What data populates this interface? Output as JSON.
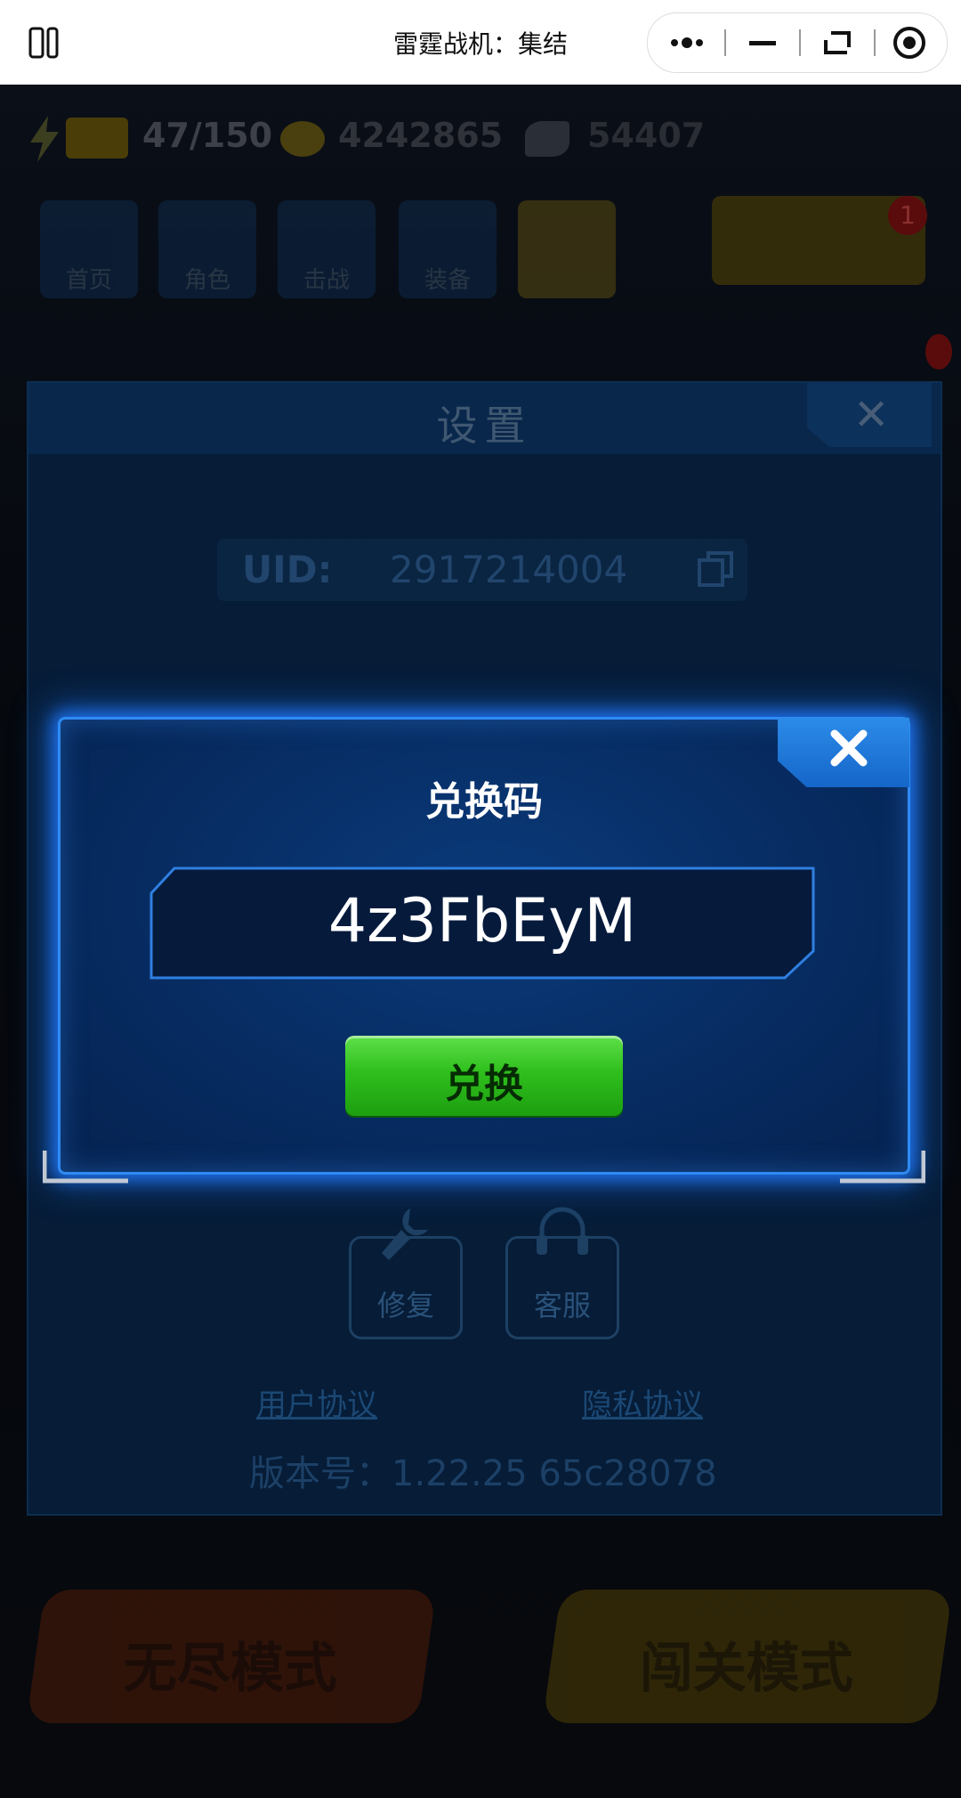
{
  "topbar": {
    "title": "雷霆战机：集结"
  },
  "game_bg": {
    "energy": "47/150",
    "coins": "4242865",
    "gems": "54407",
    "tiles": [
      "首页",
      "角色",
      "击战",
      "装备"
    ],
    "badge_count": "1"
  },
  "settings": {
    "title": "设置",
    "uid_label": "UID:",
    "uid_value": "2917214004",
    "repair_label": "修复",
    "service_label": "客服",
    "user_agreement": "用户协议",
    "privacy_agreement": "隐私协议",
    "version": "版本号：1.22.25   65c28078"
  },
  "modes": {
    "endless": "无尽模式",
    "stage": "闯关模式"
  },
  "redeem": {
    "title": "兑换码",
    "code_value": "4z3FbEyM",
    "button_label": "兑换"
  },
  "colors": {
    "dialog_border": "#2f8bf5",
    "button_green": "#2fbf1d"
  }
}
